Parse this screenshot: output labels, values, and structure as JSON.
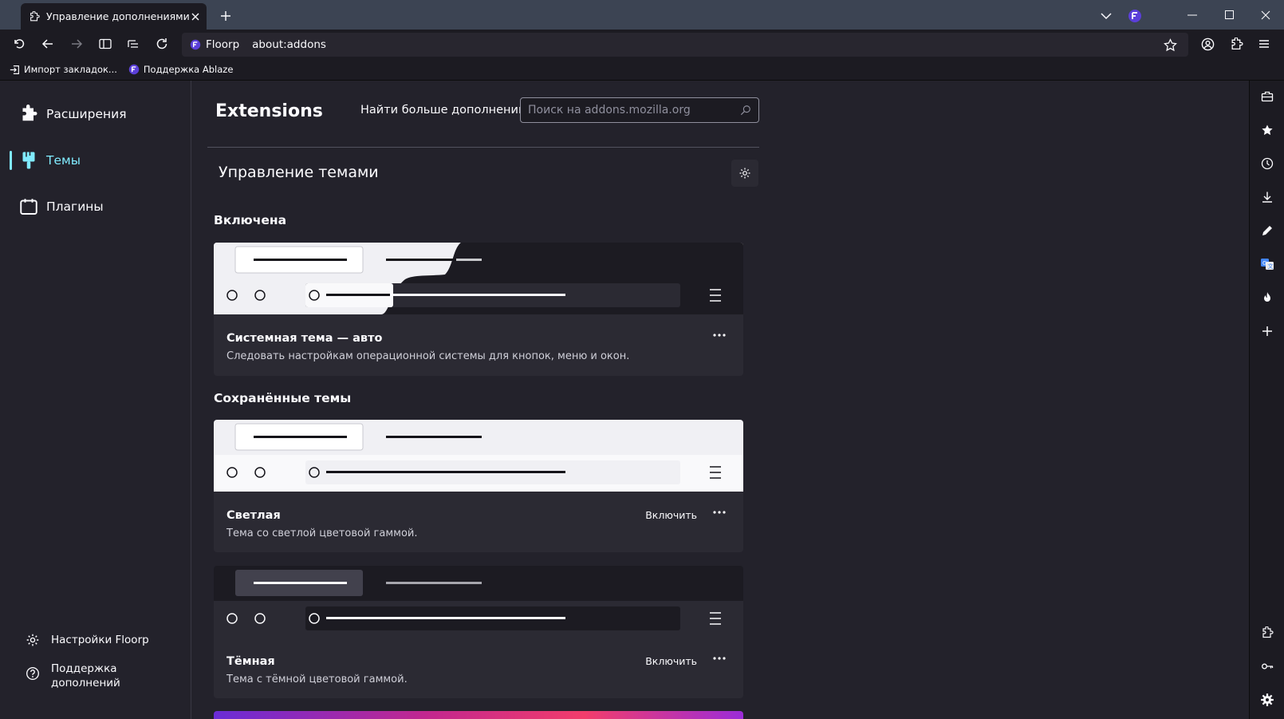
{
  "window": {
    "tab_title": "Управление дополнениями",
    "new_tab_icon": "plus-icon",
    "controls": [
      "minimize",
      "maximize",
      "close"
    ]
  },
  "navbar": {
    "identity_label": "Floorp",
    "url": "about:addons"
  },
  "bookmarks": [
    {
      "label": "Импорт закладок...",
      "icon": "import-icon"
    },
    {
      "label": "Поддержка Ablaze",
      "icon": "floorp-icon"
    }
  ],
  "sidebar": {
    "categories": [
      {
        "label": "Расширения",
        "icon": "puzzle-icon",
        "selected": false
      },
      {
        "label": "Темы",
        "icon": "brush-icon",
        "selected": true
      },
      {
        "label": "Плагины",
        "icon": "plugin-icon",
        "selected": false
      }
    ],
    "footer": [
      {
        "label": "Настройки Floorp",
        "icon": "gear-icon"
      },
      {
        "label": "Поддержка дополнений",
        "icon": "help-icon"
      }
    ]
  },
  "main": {
    "heading": "Extensions",
    "find_more_label": "Найти больше дополнений",
    "search_placeholder": "Поиск на addons.mozilla.org",
    "section_heading": "Управление темами",
    "enabled_heading": "Включена",
    "saved_heading": "Сохранённые темы",
    "themes": [
      {
        "name": "Системная тема — авто",
        "description": "Следовать настройкам операционной системы для кнопок, меню и окон.",
        "enable_label": "",
        "state": "enabled"
      },
      {
        "name": "Светлая",
        "description": "Тема со светлой цветовой гаммой.",
        "enable_label": "Включить",
        "state": "saved"
      },
      {
        "name": "Тёмная",
        "description": "Тема с тёмной цветовой гаммой.",
        "enable_label": "Включить",
        "state": "saved"
      }
    ]
  },
  "colors": {
    "accent": "#80ebff",
    "background": "#23222b",
    "card": "#2b2a33",
    "tabbar": "#3c4453"
  }
}
